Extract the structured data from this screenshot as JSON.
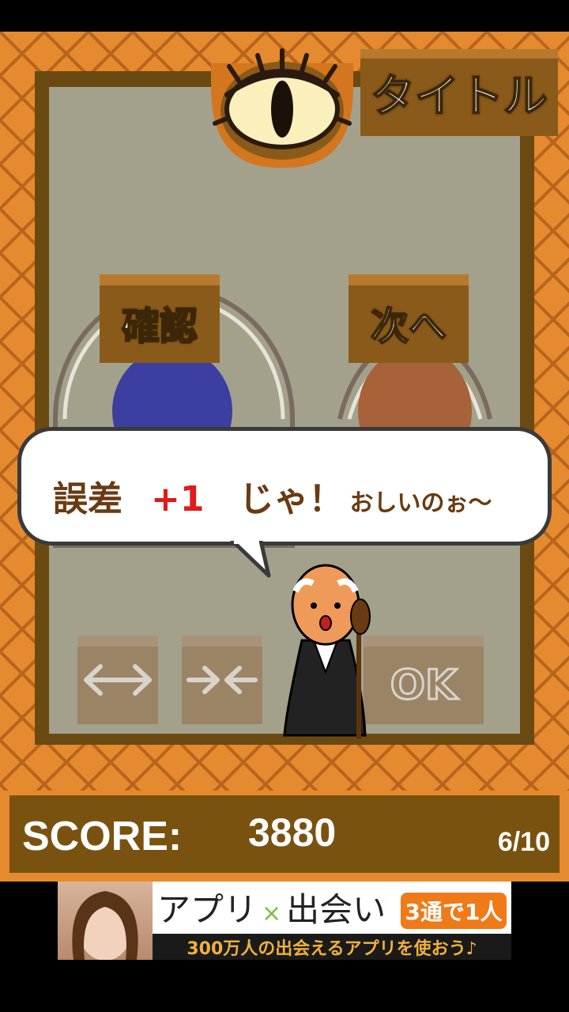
{
  "title_button": {
    "label": "タイトル"
  },
  "buttons": {
    "confirm": "確認",
    "next": "次へ",
    "ok": "OK"
  },
  "bubble": {
    "word": "誤差",
    "error": "+1",
    "exclaim": "じゃ！",
    "comment": "おしいのぉ〜"
  },
  "score": {
    "label": "SCORE:",
    "value": "3880",
    "progress": "6/10"
  },
  "ad": {
    "headline_a": "アプリ",
    "headline_x": "×",
    "headline_b": "出会い",
    "badge": "3通で1人",
    "sub": "300万人の出会えるアプリを使おう♪"
  },
  "colors": {
    "frame": "#e58a2e",
    "board": "#a3a18b",
    "button": "#8a5a1a",
    "blue_dial": "#3c3fa0",
    "brown_dial": "#a7623a",
    "error_red": "#e01a1a"
  },
  "icons": [
    "eye-icon",
    "widen-arrows-icon",
    "narrow-arrows-icon",
    "old-man-character"
  ]
}
